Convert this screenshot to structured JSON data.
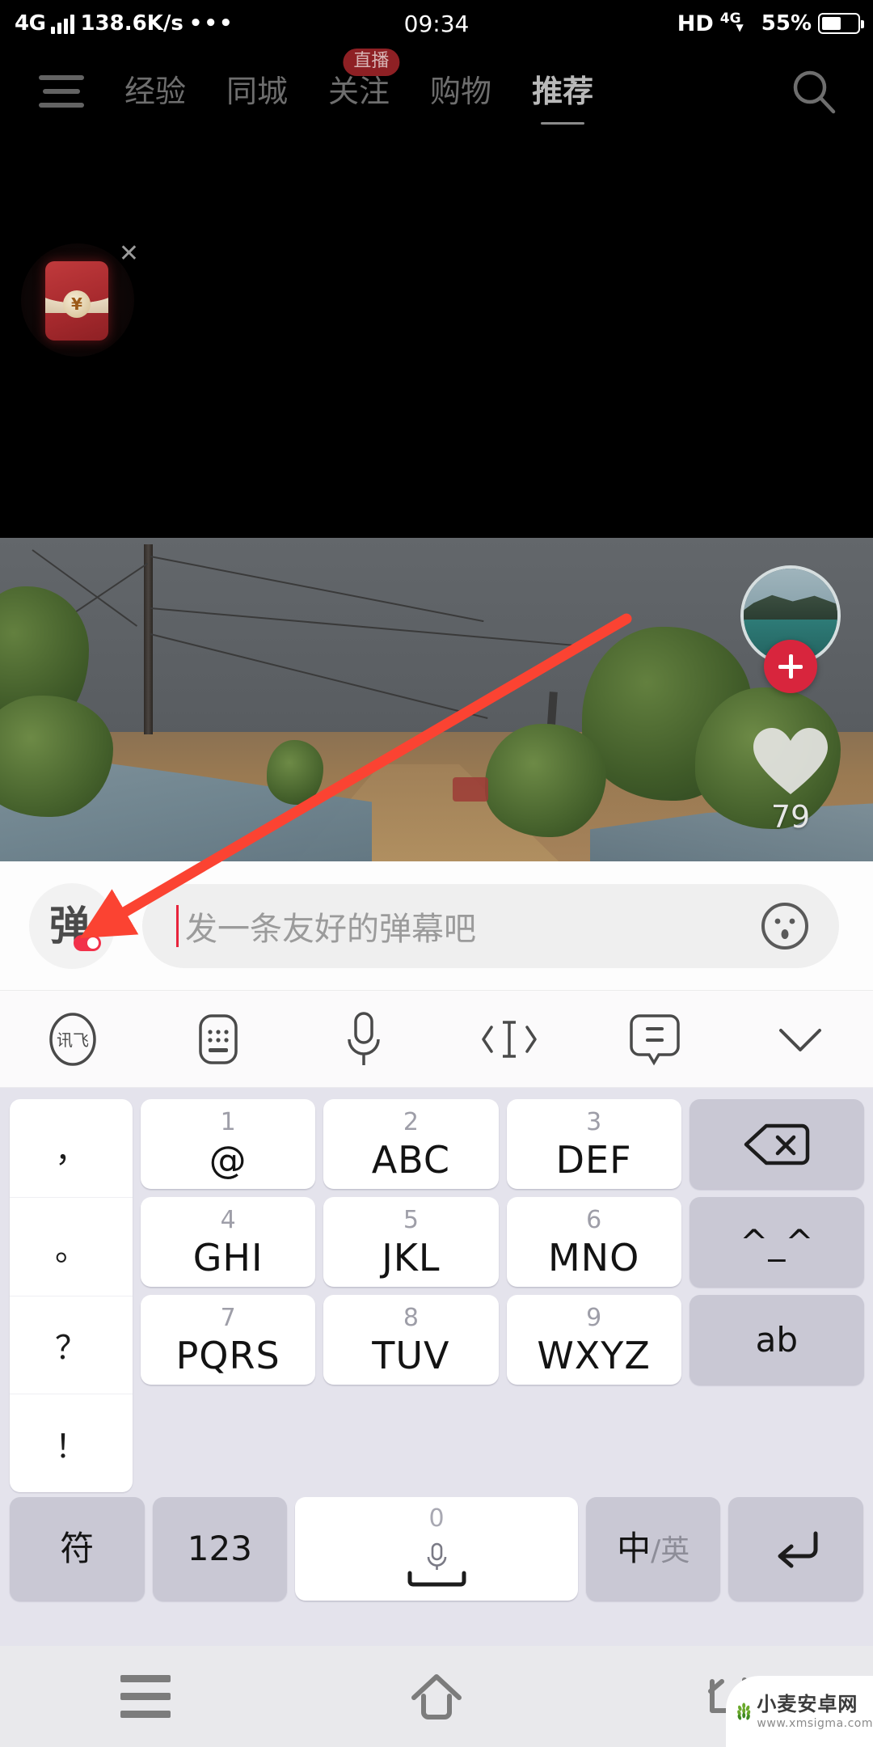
{
  "status_bar": {
    "network_type": "4G",
    "speed": "138.6K/s",
    "dots": "•••",
    "time": "09:34",
    "hd": "HD",
    "secondary_network": "4G",
    "battery_percent": "55%"
  },
  "top_nav": {
    "menu_icon": "hamburger-icon",
    "tabs": [
      {
        "label": "经验",
        "active": false,
        "badge": null
      },
      {
        "label": "同城",
        "active": false,
        "badge": null
      },
      {
        "label": "关注",
        "active": false,
        "badge": "直播"
      },
      {
        "label": "购物",
        "active": false,
        "badge": null
      },
      {
        "label": "推荐",
        "active": true,
        "badge": null
      }
    ],
    "search_icon": "search-icon"
  },
  "red_packet": {
    "icon": "red-envelope-icon",
    "currency_symbol": "¥",
    "close_label": "✕"
  },
  "video": {
    "avatar": "user-avatar",
    "follow_label": "+",
    "like_icon": "heart-icon",
    "like_count": "79"
  },
  "annotation": {
    "arrow_color": "#fb4332",
    "target": "danmaku-toggle-button"
  },
  "input_bar": {
    "danmaku_button_label": "弹",
    "danmaku_toggle_state": "on",
    "placeholder": "发一条友好的弹幕吧",
    "value": "",
    "emoji_icon": "emoji-face-icon"
  },
  "keyboard_toolbar": {
    "items": [
      {
        "name": "iflytek-logo-icon",
        "label": "讯飞"
      },
      {
        "name": "keyboard-switch-icon",
        "label": ""
      },
      {
        "name": "microphone-icon",
        "label": ""
      },
      {
        "name": "cursor-move-icon",
        "label": ""
      },
      {
        "name": "phrase-icon",
        "label": ""
      },
      {
        "name": "collapse-keyboard-icon",
        "label": ""
      }
    ]
  },
  "keyboard": {
    "punctuation": [
      "，",
      "。",
      "？",
      "！"
    ],
    "rows": [
      [
        {
          "num": "1",
          "letters": "@",
          "type": "key"
        },
        {
          "num": "2",
          "letters": "ABC",
          "type": "key"
        },
        {
          "num": "3",
          "letters": "DEF",
          "type": "key"
        },
        {
          "num": "",
          "letters": "",
          "type": "fn",
          "icon": "backspace-icon"
        }
      ],
      [
        {
          "num": "4",
          "letters": "GHI",
          "type": "key"
        },
        {
          "num": "5",
          "letters": "JKL",
          "type": "key"
        },
        {
          "num": "6",
          "letters": "MNO",
          "type": "key"
        },
        {
          "num": "",
          "letters": "^_^",
          "type": "fn",
          "icon": "emoticon-key"
        }
      ],
      [
        {
          "num": "7",
          "letters": "PQRS",
          "type": "key"
        },
        {
          "num": "8",
          "letters": "TUV",
          "type": "key"
        },
        {
          "num": "9",
          "letters": "WXYZ",
          "type": "key"
        },
        {
          "num": "",
          "letters": "ab",
          "type": "fn",
          "icon": "latin-mode-key"
        }
      ]
    ],
    "bottom_row": {
      "symbol_label": "符",
      "numeric_label": "123",
      "space_zero": "0",
      "space_icon": "microphone-icon",
      "lang_label_cn": "中",
      "lang_label_sep": "/",
      "lang_label_en": "英",
      "enter_icon": "enter-icon"
    }
  },
  "android_nav": {
    "recent_icon": "recent-apps-icon",
    "home_icon": "home-icon",
    "back_icon": "back-icon"
  },
  "watermark": {
    "name": "小麦安卓网",
    "url": "www.xmsigma.com"
  },
  "colors": {
    "accent_red": "#d8253d",
    "danmaku_toggle": "#f2314a",
    "arrow": "#fb4332",
    "keyboard_bg": "#e4e3ec"
  }
}
